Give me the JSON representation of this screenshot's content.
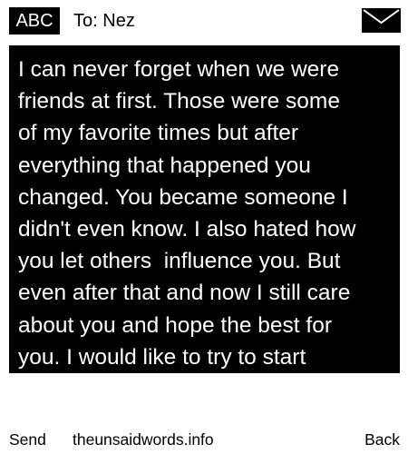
{
  "header": {
    "input_mode": "ABC",
    "to_label": "To:",
    "recipient": "Nez",
    "icon": "envelope-icon"
  },
  "message": {
    "lines": [
      "I can never forget when we were",
      "friends at first. Those were some",
      "of my favorite times but after",
      "everything that happened you",
      "changed. You became someone I",
      "didn't even know. I also hated how",
      "you let others  influence you. But",
      "even after that and now I still care",
      "about you and hope the best for",
      "you. I would like to try to start"
    ]
  },
  "softkeys": {
    "left": "Send",
    "center_text": "theunsaidwords.info",
    "right": "Back"
  },
  "colors": {
    "background": "#ffffff",
    "text_area": "#000000",
    "text_on_dark": "#ffffff",
    "text": "#000000"
  }
}
